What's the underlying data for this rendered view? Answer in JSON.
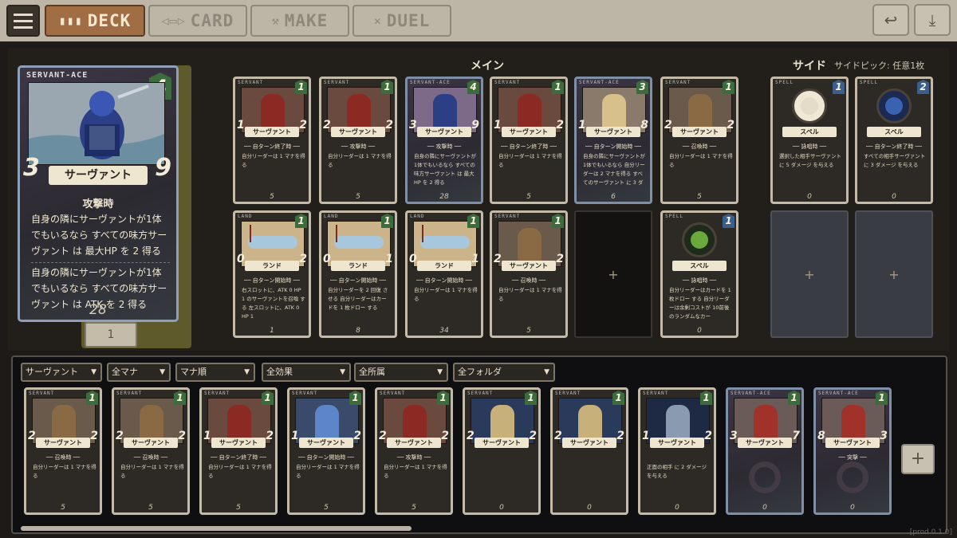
{
  "topbar": {
    "tabs": [
      {
        "label": "DECK",
        "icon": "deck-icon",
        "active": true
      },
      {
        "label": "CARD",
        "icon": "card-icon",
        "active": false
      },
      {
        "label": "MAKE",
        "icon": "make-icon",
        "active": false
      },
      {
        "label": "DUEL",
        "icon": "duel-icon",
        "active": false
      }
    ],
    "back_icon": "↩",
    "download_icon": "⤓"
  },
  "sections": {
    "main_label": "メイン",
    "side_label": "サイド",
    "side_sub": "サイドピック: 任意1枚"
  },
  "detail_card": {
    "type": "SERVANT-ACE",
    "cost": "4",
    "atk": "3",
    "hp": "9",
    "name": "サーヴァント",
    "keyword": "攻撃時",
    "desc": "自身の隣にサーヴァントが1体でもいるなら すべての味方サーヴァント は 最大HP を 2 得る",
    "desc2": "自身の隣にサーヴァントが1体でもいるなら すべての味方サーヴァント は ATK を 2 得る",
    "count": "28",
    "badge": "1"
  },
  "main_cards": [
    {
      "type": "SERVANT",
      "cost": "1",
      "atk": "1",
      "hp": "2",
      "name": "サーヴァント",
      "kw": "自ターン終了時",
      "desc": "自分リーダーは 1 マナを得る",
      "count": "5",
      "rainbow": false,
      "art": "knight"
    },
    {
      "type": "SERVANT",
      "cost": "1",
      "atk": "2",
      "hp": "2",
      "name": "サーヴァント",
      "kw": "攻撃時",
      "desc": "自分リーダーは 1 マナを得る",
      "count": "5",
      "rainbow": false,
      "art": "knight"
    },
    {
      "type": "SERVANT-ACE",
      "cost": "4",
      "atk": "3",
      "hp": "9",
      "name": "サーヴァント",
      "kw": "攻撃時",
      "desc": "自身の隣にサーヴァントが1体でもいるなら すべての味方サーヴァント は 最大HP を 2 得る",
      "count": "28",
      "rainbow": true,
      "art": "blueknight"
    },
    {
      "type": "SERVANT",
      "cost": "1",
      "atk": "1",
      "hp": "2",
      "name": "サーヴァント",
      "kw": "自ターン終了時",
      "desc": "自分リーダーは 1 マナを得る",
      "count": "5",
      "rainbow": false,
      "art": "knight"
    },
    {
      "type": "SERVANT-ACE",
      "cost": "3",
      "atk": "1",
      "hp": "8",
      "name": "サーヴァント",
      "kw": "自ターン開始時",
      "desc": "自身の隣にサーヴァントが1体でもいるなら 自分リーダーは 2 マナを得る すべてのサーヴァント に 3 ダ",
      "count": "6",
      "rainbow": true,
      "art": "girl"
    },
    {
      "type": "SERVANT",
      "cost": "1",
      "atk": "2",
      "hp": "2",
      "name": "サーヴァント",
      "kw": "召喚時",
      "desc": "自分リーダーは 1 マナを得る",
      "count": "5",
      "rainbow": false,
      "art": "monk"
    },
    {
      "type": "LAND",
      "cost": "1",
      "atk": "0",
      "hp": "2",
      "name": "ランド",
      "kw": "自ターン開始時",
      "desc": "右スロットに、ATK 0 HP 1 のサーヴァントを召喚 する 左スロットに、ATK 0 HP 1",
      "count": "1",
      "rainbow": false,
      "art": "land"
    },
    {
      "type": "LAND",
      "cost": "1",
      "atk": "0",
      "hp": "1",
      "name": "ランド",
      "kw": "自ターン開始時",
      "desc": "自分リーダーを 2 回復 させる 自分リーダーはカードを 1 枚ドロー する",
      "count": "8",
      "rainbow": false,
      "art": "land"
    },
    {
      "type": "LAND",
      "cost": "1",
      "atk": "0",
      "hp": "1",
      "name": "ランド",
      "kw": "自ターン開始時",
      "desc": "自分リーダーは 1 マナを得る",
      "count": "34",
      "rainbow": false,
      "art": "land"
    },
    {
      "type": "SERVANT",
      "cost": "1",
      "atk": "2",
      "hp": "2",
      "name": "サーヴァント",
      "kw": "召喚時",
      "desc": "自分リーダーは 1 マナを得る",
      "count": "5",
      "rainbow": false,
      "art": "monk"
    },
    null,
    {
      "type": "SPELL",
      "cost": "1",
      "atk": "",
      "hp": "",
      "name": "スペル",
      "kw": "詠唱時",
      "desc": "自分リーダーはカードを 1 枚ドロー する 自分リーダーは余剰コストが 10前後のランダムなカー",
      "count": "0",
      "rainbow": false,
      "art": "leaf"
    }
  ],
  "side_cards": [
    {
      "type": "SPELL",
      "cost": "1",
      "atk": "",
      "hp": "",
      "name": "スペル",
      "kw": "詠唱時",
      "desc": "選択した相手サーヴァントに 5 ダメージ を与える",
      "count": "0",
      "rainbow": false,
      "art": "swirl"
    },
    {
      "type": "SPELL",
      "cost": "2",
      "atk": "",
      "hp": "",
      "name": "スペル",
      "kw": "自ターン終了時",
      "desc": "すべての相手サーヴァントに 3 ダメージ を与える",
      "count": "0",
      "rainbow": false,
      "art": "storm"
    }
  ],
  "slot_plus": "+",
  "filters": [
    {
      "label": "サーヴァント"
    },
    {
      "label": "全マナ"
    },
    {
      "label": "マナ順"
    },
    {
      "label": "全効果"
    },
    {
      "label": "全所属"
    },
    {
      "label": "全フォルダ"
    }
  ],
  "collection": [
    {
      "type": "SERVANT",
      "cost": "1",
      "atk": "2",
      "hp": "2",
      "name": "サーヴァント",
      "kw": "召喚時",
      "desc": "自分リーダーは 1 マナを得る",
      "count": "5",
      "rainbow": false,
      "art": "monk"
    },
    {
      "type": "SERVANT",
      "cost": "1",
      "atk": "2",
      "hp": "2",
      "name": "サーヴァント",
      "kw": "召喚時",
      "desc": "自分リーダーは 1 マナを得る",
      "count": "5",
      "rainbow": false,
      "art": "monk"
    },
    {
      "type": "SERVANT",
      "cost": "1",
      "atk": "1",
      "hp": "2",
      "name": "サーヴァント",
      "kw": "自ターン終了時",
      "desc": "自分リーダーは 1 マナを得る",
      "count": "5",
      "rainbow": false,
      "art": "knight"
    },
    {
      "type": "SERVANT",
      "cost": "1",
      "atk": "1",
      "hp": "2",
      "name": "サーヴァント",
      "kw": "自ターン開始時",
      "desc": "自分リーダーは 1 マナを得る",
      "count": "5",
      "rainbow": false,
      "art": "wizard"
    },
    {
      "type": "SERVANT",
      "cost": "1",
      "atk": "2",
      "hp": "2",
      "name": "サーヴァント",
      "kw": "攻撃時",
      "desc": "自分リーダーは 1 マナを得る",
      "count": "5",
      "rainbow": false,
      "art": "knight"
    },
    {
      "type": "SERVANT",
      "cost": "1",
      "atk": "2",
      "hp": "2",
      "name": "サーヴァント",
      "kw": "",
      "desc": "",
      "count": "0",
      "rainbow": false,
      "art": "blondegirl"
    },
    {
      "type": "SERVANT",
      "cost": "1",
      "atk": "2",
      "hp": "2",
      "name": "サーヴァント",
      "kw": "",
      "desc": "",
      "count": "0",
      "rainbow": false,
      "art": "blondegirl"
    },
    {
      "type": "SERVANT",
      "cost": "1",
      "atk": "1",
      "hp": "2",
      "name": "サーヴァント",
      "kw": "",
      "desc": "正面の相手 に 2 ダメージ を与える",
      "count": "0",
      "rainbow": false,
      "art": "skeleton"
    },
    {
      "type": "SERVANT-ACE",
      "cost": "1",
      "atk": "3",
      "hp": "7",
      "name": "サーヴァント",
      "kw": "",
      "desc": "",
      "count": "0",
      "rainbow": true,
      "art": "redfig",
      "ring": true
    },
    {
      "type": "SERVANT-ACE",
      "cost": "1",
      "atk": "8",
      "hp": "3",
      "name": "サーヴァント",
      "kw": "突撃",
      "desc": "",
      "count": "0",
      "rainbow": true,
      "art": "redfig",
      "ring": true
    }
  ],
  "add_button": "+",
  "version": "[prod 0.1.0]",
  "colors": {
    "accent": "#a06d44",
    "topbar": "#bdb6a6",
    "mana": "#3c6b3d",
    "frame": "#c3bba8"
  }
}
